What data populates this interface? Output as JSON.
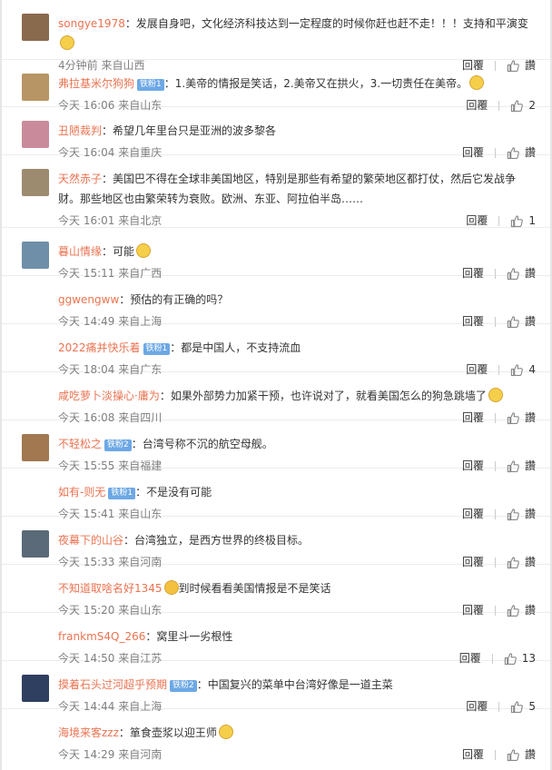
{
  "actions": {
    "reply_label": "回覆",
    "like_label": "讚"
  },
  "comments": [
    {
      "user": "songye1978",
      "badge": "",
      "text": "：发展自身吧，文化经济科技达到一定程度的时候你赶也赶不走！！！支持和平演变",
      "emoji_after": true,
      "time": "4分钟前 来自山西",
      "likes": "",
      "avatar_color": "#8a6a4d"
    },
    {
      "user": "弗拉基米尔狗狗",
      "badge": "铁粉1",
      "text": "：1.美帝的情报是笑话，2.美帝又在拱火，3.一切责任在美帝。",
      "emoji_after": true,
      "time": "今天 16:06 来自山东",
      "likes": "2",
      "avatar_color": "#b79564"
    },
    {
      "user": "丑陋裁判",
      "badge": "",
      "text": "：希望几年里台只是亚洲的波多黎各",
      "emoji_after": false,
      "time": "今天 16:04 来自重庆",
      "likes": "",
      "avatar_color": "#c98b9b"
    },
    {
      "user": "天然赤子",
      "badge": "",
      "text": "：美国巴不得在全球非美国地区，特别是那些有希望的繁荣地区都打仗，然后它发战争财。那些地区也由繁荣转为衰败。欧洲、东亚、阿拉伯半岛……",
      "emoji_after": false,
      "time": "今天 16:01 来自北京",
      "likes": "1",
      "avatar_color": "#9d8b6f"
    },
    {
      "user": "暮山情缘",
      "badge": "",
      "text": "：可能",
      "emoji_after": true,
      "time": "今天 15:11 来自广西",
      "likes": "",
      "avatar_color": "#6f8fa8"
    },
    {
      "user": "ggwengww",
      "badge": "",
      "text": "：预估的有正确的吗？",
      "emoji_after": false,
      "time": "今天 14:49 来自上海",
      "likes": "",
      "avatar_color": ""
    },
    {
      "user": "2022痛并快乐着",
      "badge": "铁粉1",
      "text": "：都是中国人，不支持流血",
      "emoji_after": false,
      "time": "今天 18:04 来自广东",
      "likes": "4",
      "avatar_color": ""
    },
    {
      "user": "咸吃萝卜淡操心·庸为",
      "badge": "",
      "text": "：如果外部势力加紧干预，也许说对了，就看美国怎么的狗急跳墙了",
      "emoji_after": true,
      "time": "今天 16:08 来自四川",
      "likes": "",
      "avatar_color": ""
    },
    {
      "user": "不轻松之",
      "badge": "铁粉2",
      "text": "：台湾号称不沉的航空母舰。",
      "emoji_after": false,
      "time": "今天 15:55 来自福建",
      "likes": "",
      "avatar_color": "#a1784f"
    },
    {
      "user": "如有-则无",
      "badge": "铁粉1",
      "text": "：不是没有可能",
      "emoji_after": false,
      "time": "今天 15:41 来自山东",
      "likes": "",
      "avatar_color": ""
    },
    {
      "user": "夜幕下的山谷",
      "badge": "",
      "text": "：台湾独立，是西方世界的终极目标。",
      "emoji_after": false,
      "time": "今天 15:33 来自河南",
      "likes": "",
      "avatar_color": "#5a6a78"
    },
    {
      "user": "不知道取啥名好1345",
      "badge": "",
      "text": "到时候看看美国情报是不是笑话",
      "emoji_before": true,
      "emoji_after": false,
      "time": "今天 15:20 来自山东",
      "likes": "",
      "avatar_color": ""
    },
    {
      "user": "frankmS4Q_266",
      "badge": "",
      "text": "：窝里斗一劣根性",
      "emoji_after": false,
      "time": "今天 14:50 来自江苏",
      "likes": "13",
      "avatar_color": ""
    },
    {
      "user": "摸着石头过河超乎预期",
      "badge": "铁粉2",
      "text": "：中国复兴的菜单中台湾好像是一道主菜",
      "emoji_after": false,
      "time": "今天 14:44 来自上海",
      "likes": "5",
      "avatar_color": "#2f3f5f"
    },
    {
      "user": "海境来客zzz",
      "badge": "",
      "text": "：箪食壶浆以迎王师",
      "emoji_after": true,
      "time": "今天 14:29 来自河南",
      "likes": "",
      "avatar_color": ""
    }
  ]
}
